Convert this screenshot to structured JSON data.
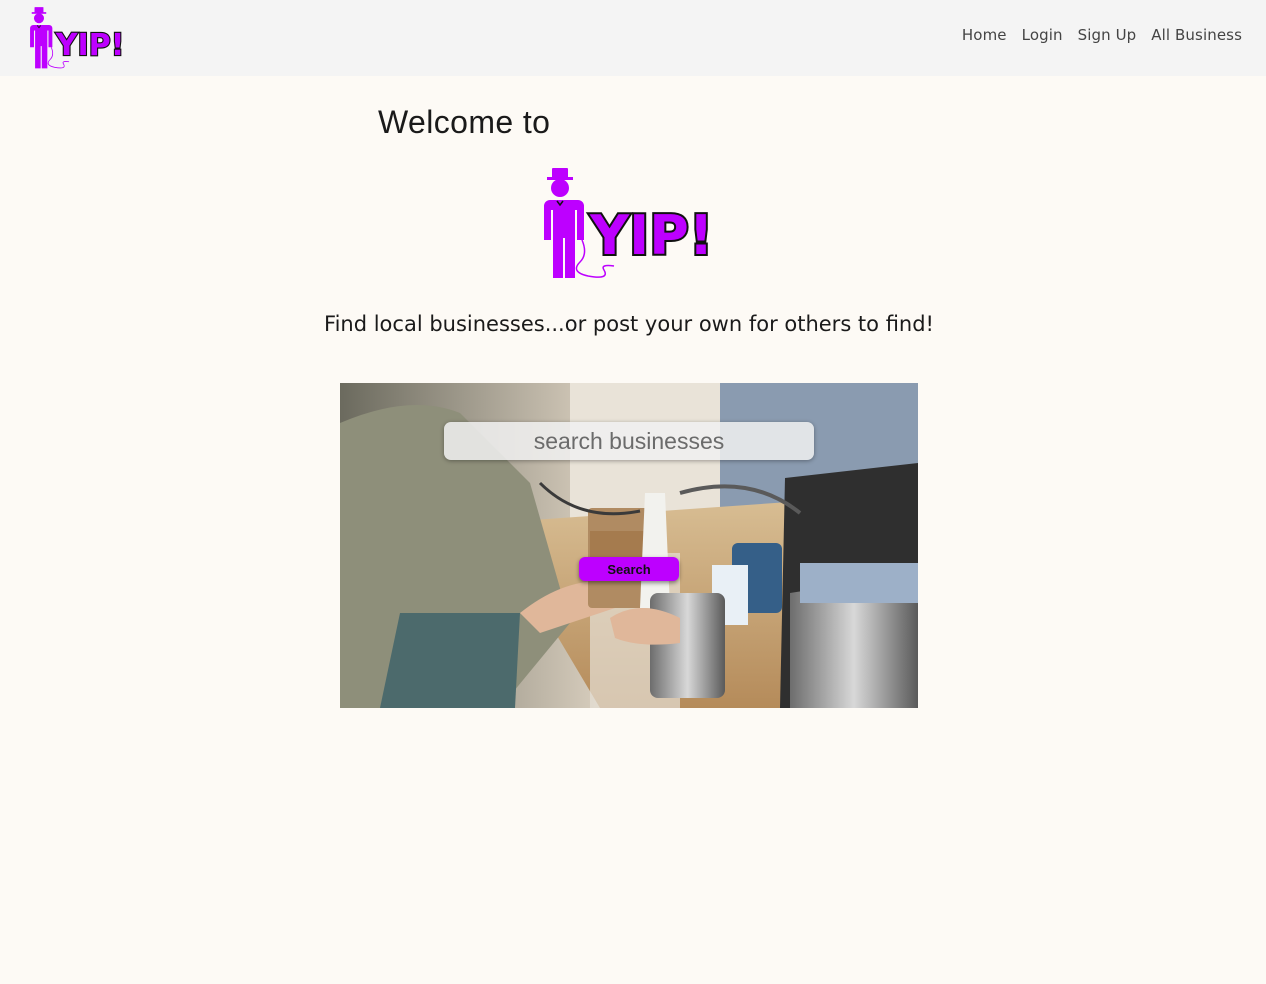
{
  "brand": {
    "logo_text": "YIP!",
    "color": "#bd00ff"
  },
  "nav": {
    "home": "Home",
    "login": "Login",
    "signup": "Sign Up",
    "all_business": "All Business"
  },
  "hero": {
    "welcome": "Welcome to",
    "tagline": "Find local businesses...or post your own for others to find!"
  },
  "search": {
    "placeholder": "search businesses",
    "button_label": "Search"
  },
  "colors": {
    "nav_bg": "#f4f4f4",
    "page_bg": "#fdfaf5",
    "accent": "#bd00ff"
  }
}
